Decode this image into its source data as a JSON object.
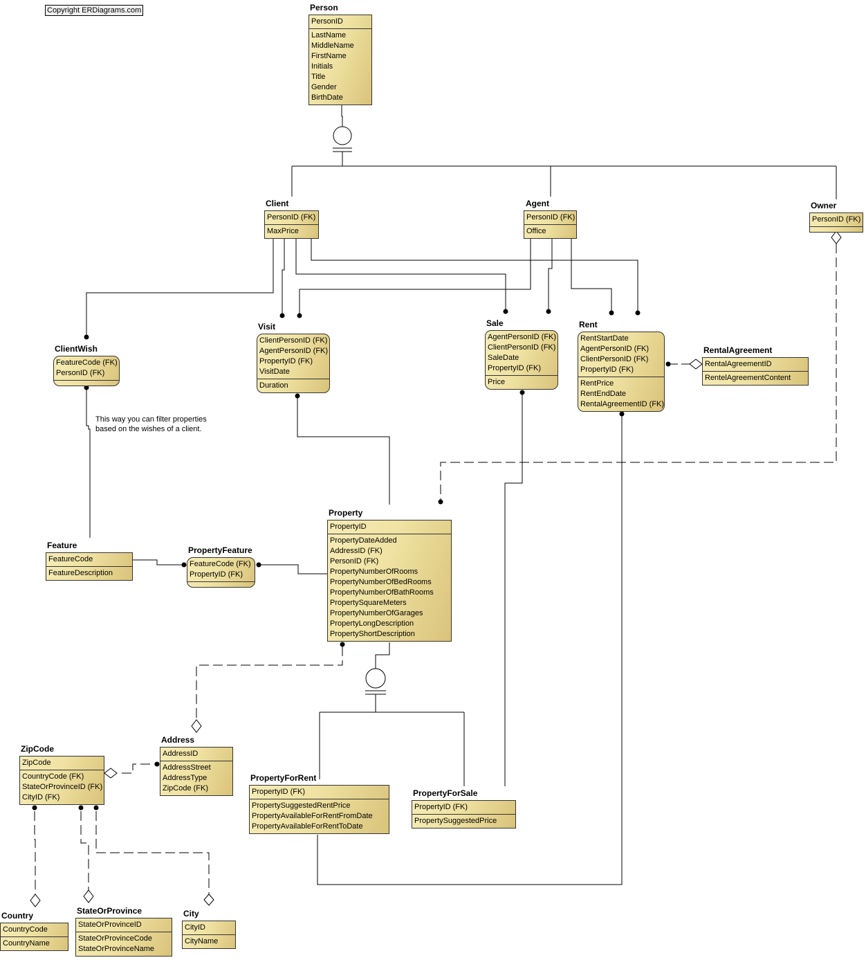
{
  "copyright": "Copyright ERDiagrams.com",
  "note": [
    "This way you can filter properties",
    "based on the wishes of a client."
  ],
  "entities": {
    "person": {
      "name": "Person",
      "keys": [
        "PersonID"
      ],
      "attrs": [
        "LastName",
        "MiddleName",
        "FirstName",
        "Initials",
        "Title",
        "Gender",
        "BirthDate"
      ]
    },
    "client": {
      "name": "Client",
      "keys": [
        "PersonID (FK)"
      ],
      "attrs": [
        "MaxPrice"
      ]
    },
    "agent": {
      "name": "Agent",
      "keys": [
        "PersonID (FK)"
      ],
      "attrs": [
        "Office"
      ]
    },
    "owner": {
      "name": "Owner",
      "keys": [
        "PersonID (FK)"
      ],
      "attrs": []
    },
    "clientwish": {
      "name": "ClientWish",
      "keys": [
        "FeatureCode (FK)",
        "PersonID (FK)"
      ],
      "attrs": []
    },
    "visit": {
      "name": "Visit",
      "keys": [
        "ClientPersonID (FK)",
        "AgentPersonID (FK)",
        "PropertyID (FK)",
        "VisitDate"
      ],
      "attrs": [
        "Duration"
      ]
    },
    "sale": {
      "name": "Sale",
      "keys": [
        "AgentPersonID (FK)",
        "ClientPersonID (FK)",
        "SaleDate",
        "PropertyID (FK)"
      ],
      "attrs": [
        "Price"
      ]
    },
    "rent": {
      "name": "Rent",
      "keys": [
        "RentStartDate",
        "AgentPersonID (FK)",
        "ClientPersonID (FK)",
        "PropertyID (FK)"
      ],
      "attrs": [
        "RentPrice",
        "RentEndDate",
        "RentalAgreementID (FK)"
      ]
    },
    "rentalagreement": {
      "name": "RentalAgreement",
      "keys": [
        "RentalAgreementID"
      ],
      "attrs": [
        "RentelAgreementContent"
      ]
    },
    "feature": {
      "name": "Feature",
      "keys": [
        "FeatureCode"
      ],
      "attrs": [
        "FeatureDescription"
      ]
    },
    "propertyfeature": {
      "name": "PropertyFeature",
      "keys": [
        "FeatureCode (FK)",
        "PropertyID (FK)"
      ],
      "attrs": []
    },
    "property": {
      "name": "Property",
      "keys": [
        "PropertyID"
      ],
      "attrs": [
        "PropertyDateAdded",
        "AddressID (FK)",
        "PersonID (FK)",
        "PropertyNumberOfRooms",
        "PropertyNumberOfBedRooms",
        "PropertyNumberOfBathRooms",
        "PropertySquareMeters",
        "PropertyNumberOfGarages",
        "PropertyLongDescription",
        "PropertyShortDescription"
      ]
    },
    "zipcode": {
      "name": "ZipCode",
      "keys": [
        "ZipCode"
      ],
      "attrs": [
        "CountryCode (FK)",
        "StateOrProvinceID (FK)",
        "CityID (FK)"
      ]
    },
    "address": {
      "name": "Address",
      "keys": [
        "AddressID"
      ],
      "attrs": [
        "AddressStreet",
        "AddressType",
        "ZipCode (FK)"
      ]
    },
    "propertyforrent": {
      "name": "PropertyForRent",
      "keys": [
        "PropertyID (FK)"
      ],
      "attrs": [
        "PropertySuggestedRentPrice",
        "PropertyAvailableForRentFromDate",
        "PropertyAvailableForRentToDate"
      ]
    },
    "propertyforsale": {
      "name": "PropertyForSale",
      "keys": [
        "PropertyID (FK)"
      ],
      "attrs": [
        "PropertySuggestedPrice"
      ]
    },
    "country": {
      "name": "Country",
      "keys": [
        "CountryCode"
      ],
      "attrs": [
        "CountryName"
      ]
    },
    "stateorprovince": {
      "name": "StateOrProvince",
      "keys": [
        "StateOrProvinceID"
      ],
      "attrs": [
        "StateOrProvinceCode",
        "StateOrProvinceName"
      ]
    },
    "city": {
      "name": "City",
      "keys": [
        "CityID"
      ],
      "attrs": [
        "CityName"
      ]
    }
  }
}
